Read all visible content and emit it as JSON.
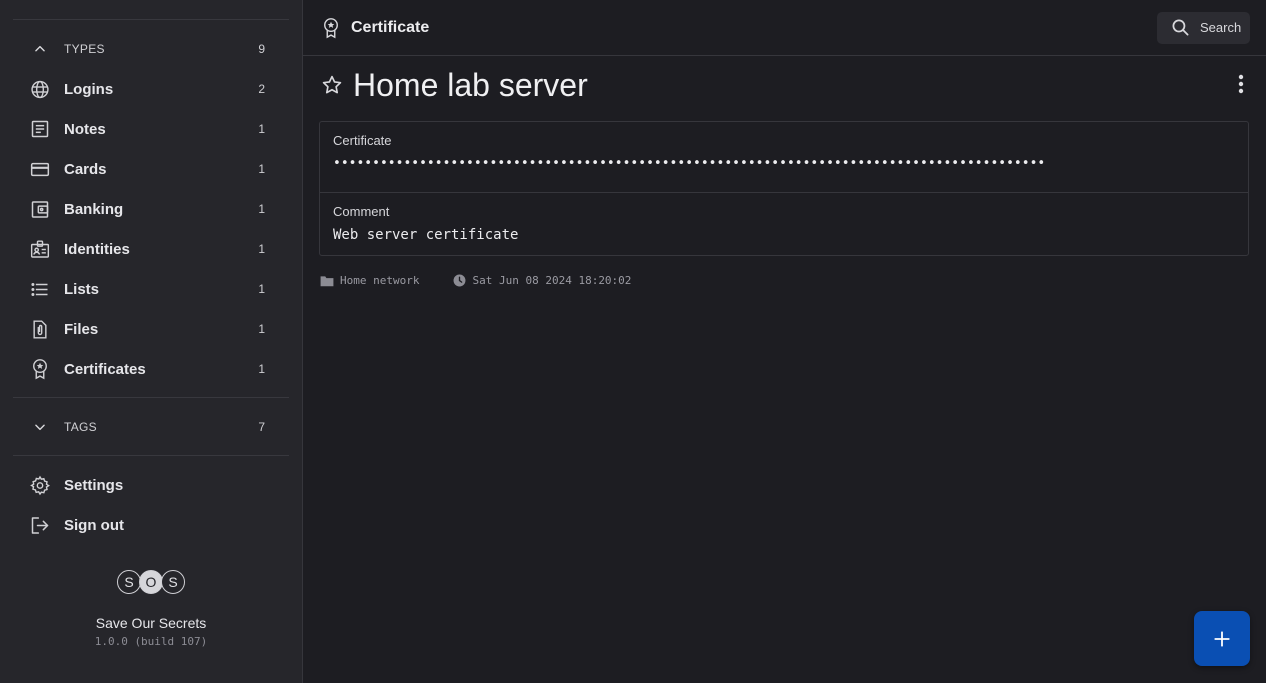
{
  "sidebar": {
    "types": {
      "label": "TYPES",
      "count": "9"
    },
    "items": [
      {
        "label": "Logins",
        "count": "2",
        "icon": "globe-icon"
      },
      {
        "label": "Notes",
        "count": "1",
        "icon": "notes-icon"
      },
      {
        "label": "Cards",
        "count": "1",
        "icon": "credit-card-icon"
      },
      {
        "label": "Banking",
        "count": "1",
        "icon": "wallet-icon"
      },
      {
        "label": "Identities",
        "count": "1",
        "icon": "id-badge-icon"
      },
      {
        "label": "Lists",
        "count": "1",
        "icon": "list-icon"
      },
      {
        "label": "Files",
        "count": "1",
        "icon": "file-attachment-icon"
      },
      {
        "label": "Certificates",
        "count": "1",
        "icon": "certificate-icon"
      }
    ],
    "tags": {
      "label": "TAGS",
      "count": "7"
    },
    "settings_label": "Settings",
    "signout_label": "Sign out",
    "brand": {
      "letters": [
        "S",
        "O",
        "S"
      ],
      "name": "Save Our Secrets",
      "version": "1.0.0 (build 107)"
    }
  },
  "header": {
    "title": "Certificate",
    "search_label": "Search"
  },
  "secret": {
    "title": "Home lab server",
    "fields": [
      {
        "label": "Certificate",
        "value": "•••••••••••••••••••••••••••••••••••••••••••••••••••••••••••••••••••••••••••••••••••••••••••"
      },
      {
        "label": "Comment",
        "value": "Web server certificate"
      }
    ],
    "folder": "Home network",
    "timestamp": "Sat Jun 08 2024 18:20:02"
  },
  "colors": {
    "accent": "#0a4fb3",
    "background": "#1d1d22",
    "sidebar": "#26262b"
  }
}
